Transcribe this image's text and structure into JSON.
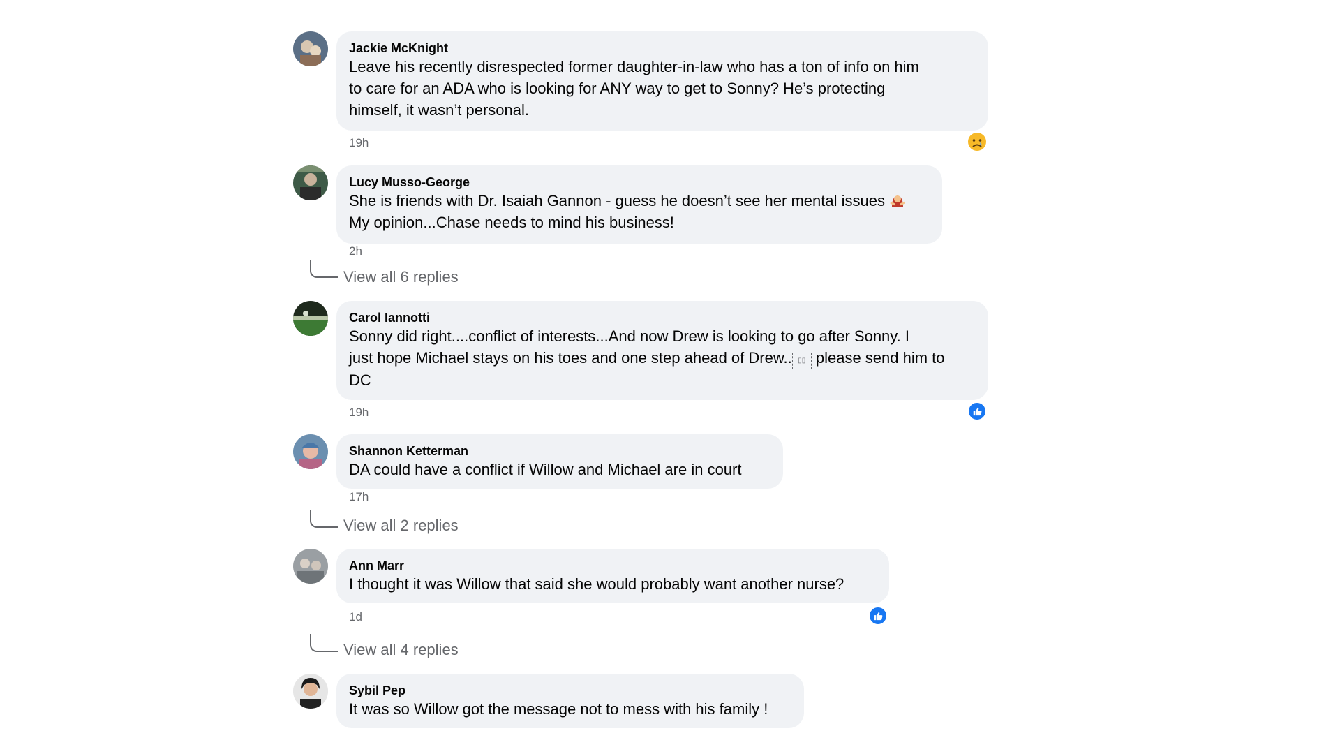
{
  "comments": [
    {
      "author": "Jackie McKnight",
      "lines": [
        "Leave his recently disrespected former daughter-in-law who has a ton of info on him",
        "to care for an ADA who is looking for ANY way to get to Sonny? He’s protecting",
        "himself, it wasn’t personal."
      ],
      "time": "19h",
      "reaction": "sad-reaction-icon"
    },
    {
      "author": "Lucy Musso-George",
      "lines": [
        "She is friends with Dr. Isaiah Gannon - guess he doesn’t see her mental issues",
        "My opinion...Chase needs to mind his business!"
      ],
      "time": "2h",
      "replies": "View all 6 replies"
    },
    {
      "author": "Carol Iannotti",
      "lines": [
        "Sonny did right....conflict of interests...And now Drew is looking to go after Sonny. I",
        "just hope Michael stays on his toes and one step ahead of Drew..",
        " please send him to",
        "DC"
      ],
      "time": "19h",
      "reaction": "like-reaction-icon"
    },
    {
      "author": "Shannon Ketterman",
      "lines": [
        "DA could have a conflict if Willow and Michael are in court"
      ],
      "time": "17h",
      "replies": "View all 2 replies"
    },
    {
      "author": "Ann Marr",
      "lines": [
        "I thought it was Willow that said she would probably want another nurse?"
      ],
      "time": "1d",
      "reaction": "like-reaction-icon",
      "replies": "View all 4 replies"
    },
    {
      "author": "Sybil Pep",
      "lines": [
        "It was so Willow got the message not to mess with his family !"
      ]
    }
  ],
  "colors": {
    "bubble": "#f0f2f5",
    "meta": "#65676b",
    "like": "#1877f2"
  }
}
